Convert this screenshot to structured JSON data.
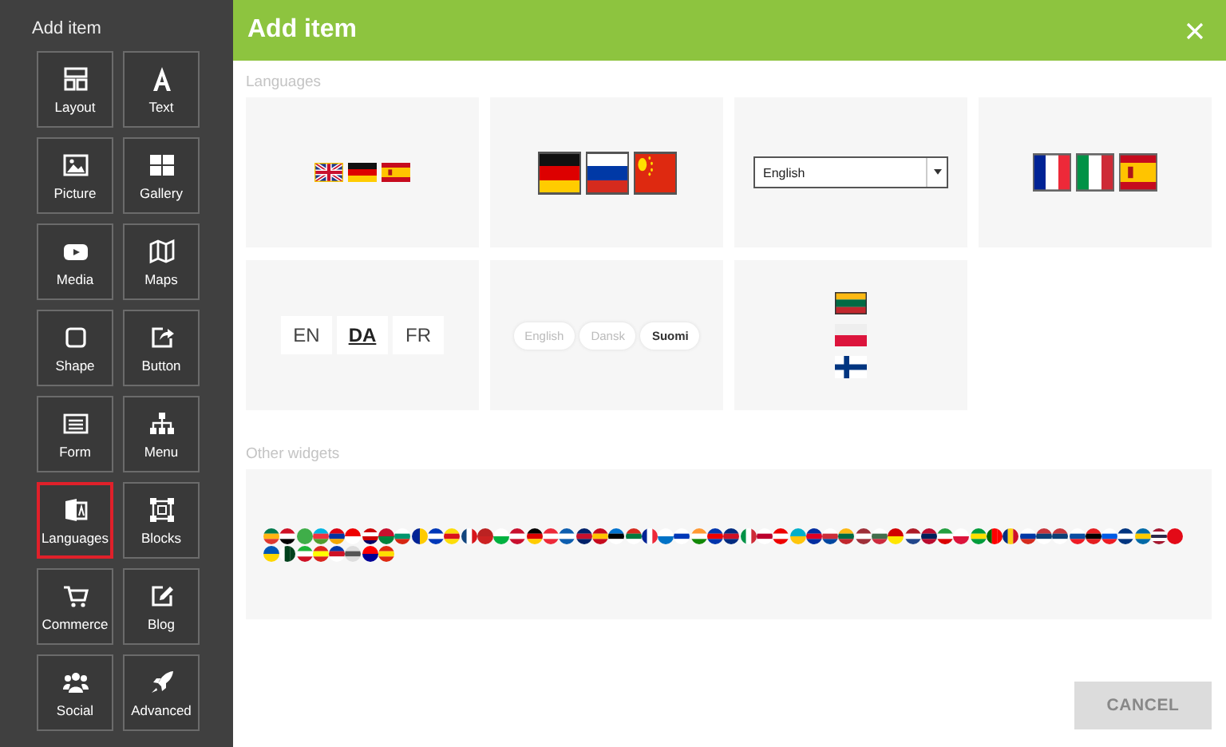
{
  "sidebar": {
    "title": "Add item",
    "items": [
      {
        "label": "Layout",
        "selected": false
      },
      {
        "label": "Text",
        "selected": false
      },
      {
        "label": "Picture",
        "selected": false
      },
      {
        "label": "Gallery",
        "selected": false
      },
      {
        "label": "Media",
        "selected": false
      },
      {
        "label": "Maps",
        "selected": false
      },
      {
        "label": "Shape",
        "selected": false
      },
      {
        "label": "Button",
        "selected": false
      },
      {
        "label": "Form",
        "selected": false
      },
      {
        "label": "Menu",
        "selected": false
      },
      {
        "label": "Languages",
        "selected": true
      },
      {
        "label": "Blocks",
        "selected": false
      },
      {
        "label": "Commerce",
        "selected": false
      },
      {
        "label": "Blog",
        "selected": false
      },
      {
        "label": "Social",
        "selected": false
      },
      {
        "label": "Advanced",
        "selected": false
      }
    ]
  },
  "dialog": {
    "title": "Add item",
    "languages_label": "Languages",
    "widgets": [
      {
        "kind": "flags_small"
      },
      {
        "kind": "flags_large"
      },
      {
        "kind": "dropdown",
        "value": "English"
      },
      {
        "kind": "flags_framed"
      },
      {
        "kind": "codes",
        "options": [
          {
            "label": "EN",
            "selected": false
          },
          {
            "label": "DA",
            "selected": true
          },
          {
            "label": "FR",
            "selected": false
          }
        ]
      },
      {
        "kind": "pills",
        "options": [
          {
            "label": "English",
            "selected": false
          },
          {
            "label": "Dansk",
            "selected": false
          },
          {
            "label": "Suomi",
            "selected": true
          }
        ]
      },
      {
        "kind": "flags_vertical"
      }
    ],
    "other_label": "Other widgets",
    "cancel": "CANCEL"
  }
}
